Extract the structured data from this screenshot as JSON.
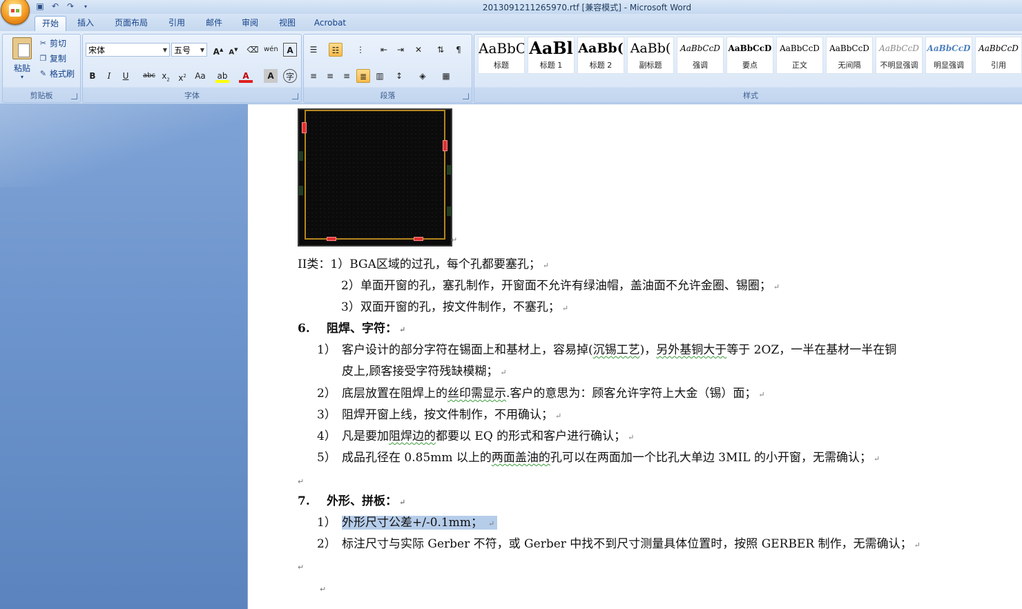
{
  "window": {
    "title": "2013091211265970.rtf [兼容模式] - Microsoft Word"
  },
  "tabs": [
    "开始",
    "插入",
    "页面布局",
    "引用",
    "邮件",
    "审阅",
    "视图",
    "Acrobat"
  ],
  "clipboard": {
    "paste": "粘贴",
    "cut": "剪切",
    "copy": "复制",
    "format_painter": "格式刷",
    "group": "剪贴板"
  },
  "font": {
    "name": "宋体",
    "size": "五号",
    "group": "字体"
  },
  "paragraph": {
    "group": "段落"
  },
  "styles": {
    "group": "样式",
    "items": [
      {
        "sample": "AaBbC(",
        "name": "标题"
      },
      {
        "sample": "AaBl",
        "name": "标题 1"
      },
      {
        "sample": "AaBb(",
        "name": "标题 2"
      },
      {
        "sample": "AaBb(",
        "name": "副标题"
      },
      {
        "sample": "AaBbCcD",
        "name": "强调"
      },
      {
        "sample": "AaBbCcD",
        "name": "要点"
      },
      {
        "sample": "AaBbCcD",
        "name": "正文"
      },
      {
        "sample": "AaBbCcD",
        "name": "无间隔"
      },
      {
        "sample": "AaBbCcD",
        "name": "不明显强调"
      },
      {
        "sample": "AaBbCcD",
        "name": "明显强调"
      },
      {
        "sample": "AaBbCcD",
        "name": "引用"
      }
    ]
  },
  "document": {
    "l1": "II类：1）BGA区域的过孔，每个孔都要塞孔；",
    "l2": "2）单面开窗的孔，塞孔制作，开窗面不允许有绿油帽，盖油面不允许金圈、锡圈；",
    "l3": "3）双面开窗的孔，按文件制作，不塞孔；",
    "h6_num": "6.",
    "h6": "阻焊、字符：",
    "s6_1_num": "1）",
    "s6_1a_pre": "客户设计的部分字符在锡面上和基材上，容易掉(",
    "s6_1a_sq1": "沉锡工艺",
    "s6_1a_mid": ")，",
    "s6_1a_sq2": "另外基铜大于",
    "s6_1a_post": "等于 2OZ，一半在基材一半在铜",
    "s6_1b": "皮上,顾客接受字符残缺模糊；",
    "s6_2_num": "2）",
    "s6_2_pre": "底层放置在阻焊上的",
    "s6_2_sq": "丝印需显示",
    "s6_2_post": ".客户的意思为：顾客允许字符上大金（锡）面；",
    "s6_3_num": "3）",
    "s6_3": "阻焊开窗上线，按文件制作，不用确认；",
    "s6_4_num": "4）",
    "s6_4_pre": "凡是要加",
    "s6_4_sq": "阻焊边的",
    "s6_4_post": "都要以 EQ 的形式和客户进行确认；",
    "s6_5_num": "5）",
    "s6_5_pre": "成品孔径在 0.85mm 以上的",
    "s6_5_sq": "两面盖油的",
    "s6_5_post": "孔可以在两面加一个比孔大单边 3MIL 的小开窗，无需确认；",
    "h7_num": "7.",
    "h7": "外形、拼板：",
    "s7_1_num": "1）",
    "s7_1": "外形尺寸公差+/-0.1mm；",
    "s7_2_num": "2）",
    "s7_2": "标注尺寸与实际 Gerber 不符，或 Gerber 中找不到尺寸测量具体位置时，按照 GERBER 制作，无需确认；"
  }
}
